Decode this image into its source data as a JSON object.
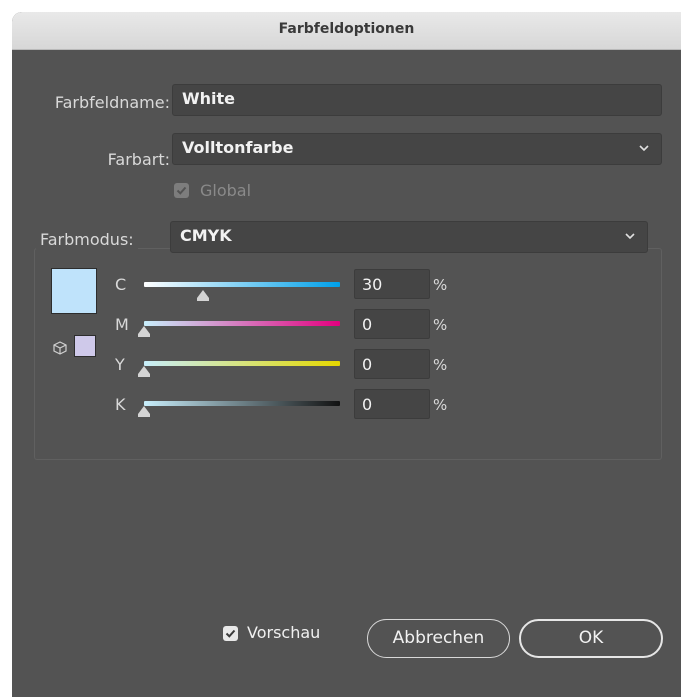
{
  "dialog": {
    "title": "Farbfeldoptionen",
    "swatch_name_label": "Farbfeldname:",
    "swatch_name_value": "White",
    "color_type_label": "Farbart:",
    "color_type_value": "Volltonfarbe",
    "global_label": "Global",
    "global_checked": true,
    "global_enabled": false,
    "color_mode_label": "Farbmodus:",
    "color_mode_value": "CMYK",
    "swatch_color": "#bfe3fb",
    "gamut_swatch_color": "#cfc9ea",
    "channels": [
      {
        "label": "C",
        "value": "30",
        "unit": "%",
        "level": 0.3,
        "from": "#ffffff",
        "to": "#00a0e9"
      },
      {
        "label": "M",
        "value": "0",
        "unit": "%",
        "level": 0.0,
        "from": "#c8eefb",
        "to": "#e4007f"
      },
      {
        "label": "Y",
        "value": "0",
        "unit": "%",
        "level": 0.0,
        "from": "#c8eefb",
        "to": "#e5d800"
      },
      {
        "label": "K",
        "value": "0",
        "unit": "%",
        "level": 0.0,
        "from": "#c8eefb",
        "to": "#111111"
      }
    ],
    "preview_label": "Vorschau",
    "preview_checked": true,
    "cancel_label": "Abbrechen",
    "ok_label": "OK"
  }
}
